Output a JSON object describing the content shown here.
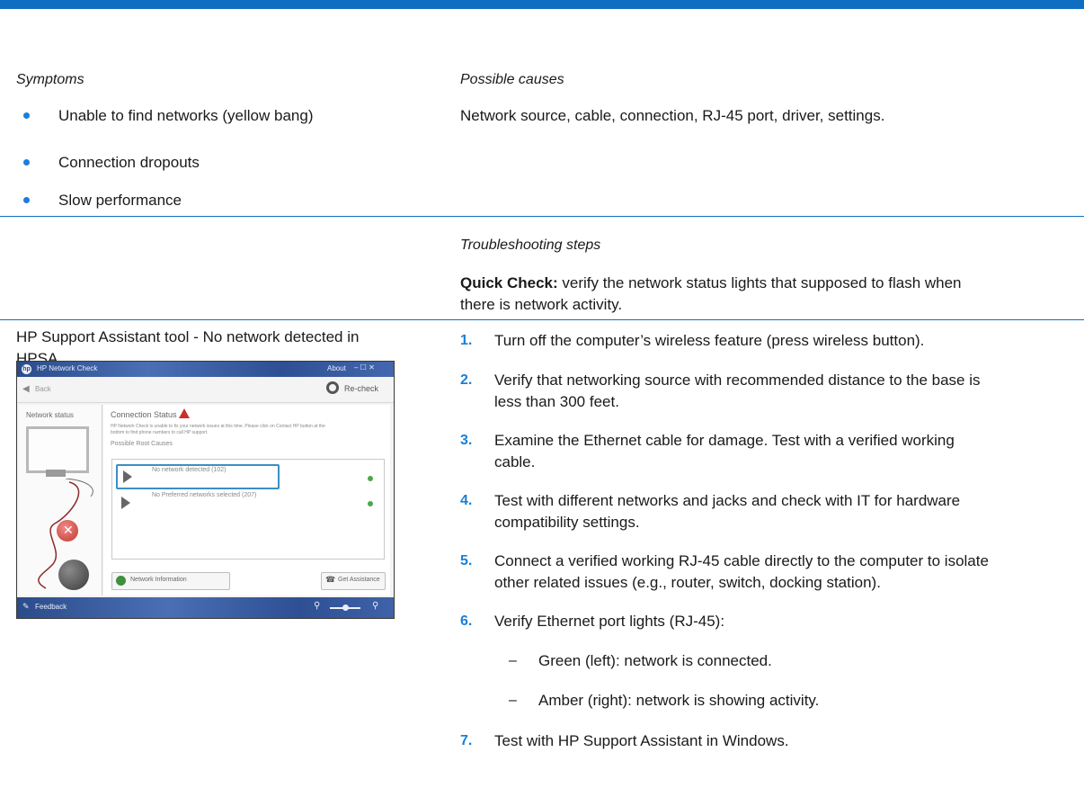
{
  "table": {
    "symptoms_header": "Symptoms",
    "causes_header": "Possible causes",
    "symptoms": [
      "Unable to find networks (yellow bang)",
      "Connection dropouts",
      "Slow performance"
    ],
    "causes_text": "Network source, cable, connection, RJ-45 port, driver, settings.",
    "troubleshooting_header": "Troubleshooting steps",
    "quick_check_label": "Quick Check:",
    "quick_check_line1": " verify the network status lights that supposed to flash when",
    "quick_check_line2": "there is network activity.",
    "tool_caption_line1": "HP Support Assistant tool - No network detected in",
    "tool_caption_line2": "HPSA"
  },
  "steps": [
    {
      "num": "1.",
      "lines": [
        "Turn off the computer’s wireless feature (press wireless button)."
      ]
    },
    {
      "num": "2.",
      "lines": [
        "Verify that networking source with recommended distance to the base is",
        "less than 300 feet."
      ]
    },
    {
      "num": "3.",
      "lines": [
        "Examine the Ethernet cable for damage. Test with a verified working",
        "cable."
      ]
    },
    {
      "num": "4.",
      "lines": [
        "Test with different networks and jacks and check with IT for hardware",
        "compatibility settings."
      ]
    },
    {
      "num": "5.",
      "lines": [
        "Connect a verified working RJ-45 cable directly to the computer to isolate",
        "other related issues (e.g., router, switch, docking station)."
      ]
    },
    {
      "num": "6.",
      "lines": [
        "Verify Ethernet port lights (RJ-45):"
      ]
    },
    {
      "num": "7.",
      "lines": [
        "Test with HP Support Assistant in Windows."
      ]
    }
  ],
  "substeps": [
    {
      "dash": "–",
      "text": "Green (left): network is connected."
    },
    {
      "dash": "–",
      "text": "Amber (right): network is showing activity."
    }
  ],
  "screenshot": {
    "title": "HP Network Check",
    "about": "About",
    "window_controls": "–   ☐   ✕",
    "back": "Back",
    "recheck": "Re-check",
    "network_status": "Network status",
    "connection_status": "Connection Status",
    "status_desc_1": "HP Network Check is unable to fix your network issues at this time. Please click on Contact HP button at the",
    "status_desc_2": "bottom to find phone numbers to call HP support.",
    "possible_root_causes": "Possible Root Causes",
    "cause1": "No network detected (102)",
    "cause2": "No Preferred networks selected (207)",
    "network_information": "Network Information",
    "get_assistance": "Get Assistance",
    "feedback": "Feedback",
    "colors": {
      "title_bar": "#2b4c8a",
      "ok": "#4aa84a",
      "error": "#d9534f",
      "warning": "#c9302c"
    }
  },
  "colors": {
    "accent": "#0f6ec2",
    "bullet": "#1a7fd6"
  }
}
